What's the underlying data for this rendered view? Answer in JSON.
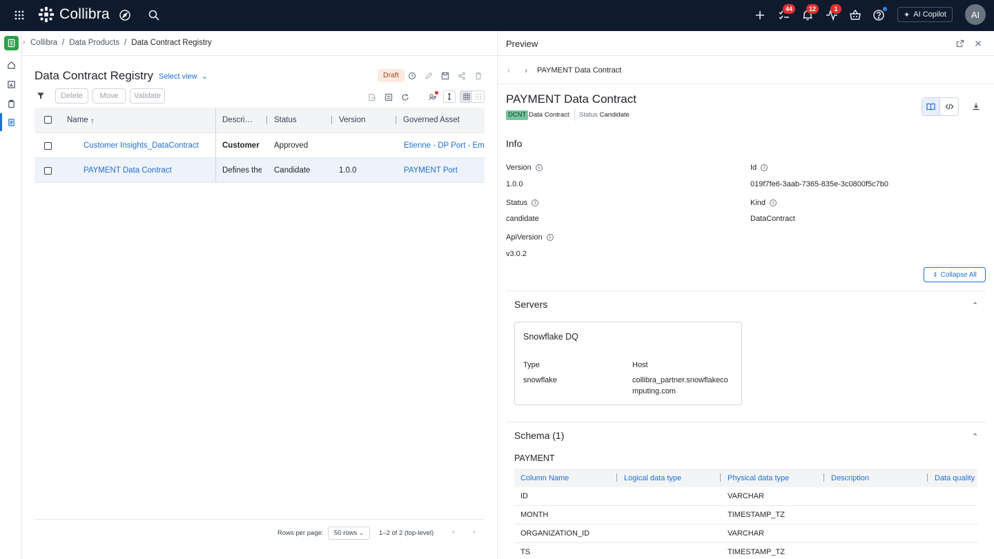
{
  "topbar": {
    "brand": "Collibra",
    "badges": {
      "tasks": "44",
      "notifications": "12",
      "activity": "1"
    },
    "copilot_label": "AI Copilot",
    "avatar_initials": "AI"
  },
  "breadcrumb": [
    "Collibra",
    "Data Products",
    "Data Contract Registry"
  ],
  "left": {
    "title": "Data Contract Registry",
    "select_view": "Select view",
    "draft": "Draft",
    "actions": {
      "delete": "Delete",
      "move": "Move",
      "validate": "Validate"
    },
    "columns": [
      "Name",
      "Descri…",
      "Status",
      "Version",
      "Governed Asset"
    ],
    "rows": [
      {
        "name": "Customer Insights_DataContract",
        "description": "Customer",
        "status": "Approved",
        "version": "",
        "governed_asset": "Etienne - DP Port - Emp"
      },
      {
        "name": "PAYMENT Data Contract",
        "description": "Defines the",
        "status": "Candidate",
        "version": "1.0.0",
        "governed_asset": "PAYMENT Port"
      }
    ],
    "footer": {
      "rows_per_page_label": "Rows per page:",
      "rows_per_page_value": "50 rows",
      "range": "1–2 of 2 (top-level)"
    }
  },
  "preview": {
    "header": "Preview",
    "nav_title": "PAYMENT Data Contract",
    "asset_title": "PAYMENT Data Contract",
    "type_badge": "DCNT",
    "type_name": "Data Contract",
    "status_label": "Status",
    "status_value": "Candidate",
    "info_heading": "Info",
    "fields": {
      "version_label": "Version",
      "version_value": "1.0.0",
      "id_label": "Id",
      "id_value": "019f7fe6-3aab-7365-835e-3c0800f5c7b0",
      "status_label": "Status",
      "status_value": "candidate",
      "kind_label": "Kind",
      "kind_value": "DataContract",
      "apiversion_label": "ApiVersion",
      "apiversion_value": "v3.0.2"
    },
    "collapse_all": "Collapse All",
    "servers_heading": "Servers",
    "server": {
      "name": "Snowflake DQ",
      "type_label": "Type",
      "type_value": "snowflake",
      "host_label": "Host",
      "host_value_1": "collibra_partner.snowflakeco",
      "host_value_2": "mputing.com"
    },
    "schema_heading": "Schema (1)",
    "schema_name": "PAYMENT",
    "schema_columns": [
      "Column Name",
      "Logical data type",
      "Physical data type",
      "Description",
      "Data quality"
    ],
    "schema_rows": [
      {
        "column": "ID",
        "physical": "VARCHAR"
      },
      {
        "column": "MONTH",
        "physical": "TIMESTAMP_TZ"
      },
      {
        "column": "ORGANIZATION_ID",
        "physical": "VARCHAR"
      },
      {
        "column": "TS",
        "physical": "TIMESTAMP_TZ"
      }
    ]
  }
}
